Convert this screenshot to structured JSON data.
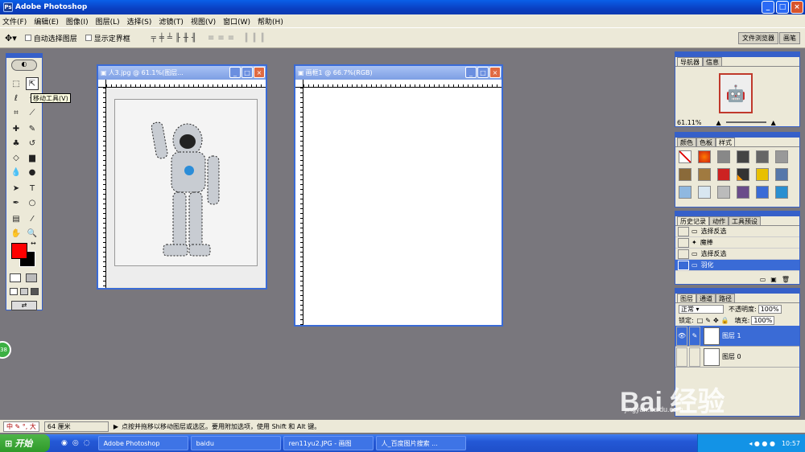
{
  "app": {
    "title": "Adobe Photoshop"
  },
  "window_buttons": [
    "_",
    "□",
    "×"
  ],
  "menu": [
    "文件(F)",
    "编辑(E)",
    "图像(I)",
    "图层(L)",
    "选择(S)",
    "滤镜(T)",
    "视图(V)",
    "窗口(W)",
    "帮助(H)"
  ],
  "options": {
    "auto_select": "自动选择图层",
    "show_bounds": "显示定界框",
    "well_tabs": [
      "文件浏览器",
      "画笔"
    ]
  },
  "tooltip": "移动工具(V)",
  "documents": [
    {
      "title": "人3.jpg @ 61.1%(图层...",
      "ruler_nums": [
        "0",
        "1",
        "2",
        "3",
        "4",
        "5"
      ]
    },
    {
      "title": "画框1 @ 66.7%(RGB)",
      "ruler_nums": [
        "0",
        "1",
        "2",
        "3",
        "4",
        "5",
        "6",
        "7",
        "8",
        "9",
        "10",
        "11"
      ]
    }
  ],
  "navigator": {
    "tabs": [
      "导航器",
      "信息"
    ],
    "zoom": "61.11%"
  },
  "colors_panel": {
    "tabs": [
      "颜色",
      "色板",
      "样式"
    ]
  },
  "history": {
    "tabs": [
      "历史记录",
      "动作",
      "工具预设"
    ],
    "items": [
      "选择反选",
      "魔棒",
      "选择反选",
      "羽化"
    ]
  },
  "layers": {
    "tabs": [
      "图层",
      "通道",
      "路径"
    ],
    "blend_mode": "正常",
    "opacity_label": "不透明度:",
    "opacity_value": "100%",
    "lock_label": "锁定:",
    "fill_label": "填充:",
    "fill_value": "100%",
    "items": [
      "图层 1",
      "图层 0"
    ]
  },
  "status": {
    "zoom": "61.1%",
    "ime": "中 ✎ °, 大",
    "doc_info": "64 厘米",
    "hint": "点按并拖移以移动图层或选区。要用附加选项，使用 Shift 和 Alt 键。"
  },
  "taskbar": {
    "start": "开始",
    "tasks": [
      "Adobe Photoshop",
      "baidu",
      "ren11yu2.JPG - 画图",
      "人_百度图片搜索 ..."
    ],
    "time": "10:57"
  },
  "watermark": {
    "brand": "Bai 经验",
    "url": "jingyan.baidu.com"
  },
  "colors": {
    "foreground": "#ff0000",
    "background": "#000000",
    "accent": "#3a6bd6"
  }
}
